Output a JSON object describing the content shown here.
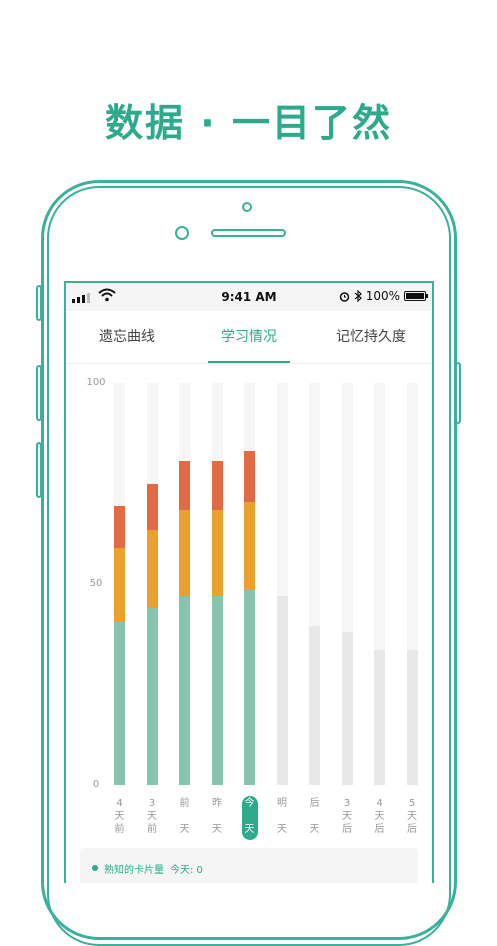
{
  "headline": "数据 · 一目了然",
  "status_bar": {
    "time": "9:41 AM",
    "battery": "100%"
  },
  "tabs": [
    {
      "label": "遗忘曲线",
      "active": false
    },
    {
      "label": "学习情况",
      "active": true
    },
    {
      "label": "记忆持久度",
      "active": false
    }
  ],
  "colors": {
    "accent": "#2daa8c",
    "mastered": "#86c4ad",
    "learning": "#eba12f",
    "new": "#e06b44",
    "future": "#e8e8e8"
  },
  "chart_data": {
    "type": "bar",
    "y_ticks": [
      "100",
      "50",
      "0"
    ],
    "ylim": [
      0,
      100
    ],
    "categories": [
      [
        "4",
        "天",
        "前"
      ],
      [
        "3",
        "天",
        "前"
      ],
      [
        "前",
        "",
        "天"
      ],
      [
        "昨",
        "",
        "天"
      ],
      [
        "今",
        "",
        "天"
      ],
      [
        "明",
        "",
        "天"
      ],
      [
        "后",
        "",
        "天"
      ],
      [
        "3",
        "天",
        "后"
      ],
      [
        "4",
        "天",
        "后"
      ],
      [
        "5",
        "天",
        "后"
      ]
    ],
    "today_index": 4,
    "series": [
      {
        "values": [
          40.5,
          44,
          47,
          47,
          48.5,
          47,
          39.5,
          38,
          33.5,
          33.5
        ]
      },
      {
        "values": [
          18.5,
          19.5,
          21.5,
          21.5,
          22
        ]
      },
      {
        "values": [
          10.5,
          11.5,
          12,
          12,
          12.5
        ]
      }
    ]
  },
  "legend": {
    "label": "熟知的卡片量",
    "today": "今天: 0"
  }
}
